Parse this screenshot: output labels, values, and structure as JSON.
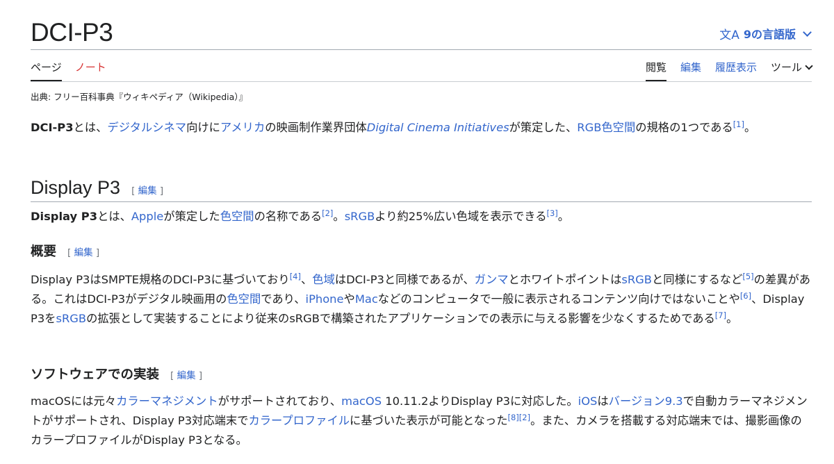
{
  "header": {
    "title": "DCI-P3",
    "language_button": {
      "icon": "文A",
      "label": "9の言語版"
    }
  },
  "tabs": {
    "left": [
      "ページ",
      "ノート"
    ],
    "right": [
      "閲覧",
      "編集",
      "履歴表示",
      "ツール"
    ]
  },
  "tagline": "出典: フリー百科事典『ウィキペディア（Wikipedia）』",
  "edit_label": "編集",
  "intro": {
    "b1": "DCI-P3",
    "t1": "とは、",
    "l1": "デジタルシネマ",
    "t2": "向けに",
    "l2": "アメリカ",
    "t3": "の映画制作業界団体",
    "l3": "Digital Cinema Initiatives",
    "t4": "が策定した、",
    "l4": "RGB色空間",
    "t5": "の規格の1つである",
    "ref1": "[1]",
    "t6": "。"
  },
  "section_display_p3": {
    "heading": "Display P3",
    "b1": "Display P3",
    "t1": "とは、",
    "l1": "Apple",
    "t2": "が策定した",
    "l2": "色空間",
    "t3": "の名称である",
    "ref1": "[2]",
    "t4": "。",
    "l3": "sRGB",
    "t5": "より約25%広い色域を表示できる",
    "ref2": "[3]",
    "t6": "。"
  },
  "section_overview": {
    "heading": "概要",
    "t1": "Display P3はSMPTE規格のDCI-P3に基づいており",
    "ref1": "[4]",
    "t2": "、",
    "l1": "色域",
    "t3": "はDCI-P3と同様であるが、",
    "l2": "ガンマ",
    "t4": "とホワイトポイントは",
    "l3": "sRGB",
    "t5": "と同様にするなど",
    "ref2": "[5]",
    "t6": "の差異がある。これはDCI-P3がデジタル映画用の",
    "l4": "色空間",
    "t7": "であり、",
    "l5": "iPhone",
    "t8": "や",
    "l6": "Mac",
    "t9": "などのコンピュータで一般に表示されるコンテンツ向けではないことや",
    "ref3": "[6]",
    "t10": "、Display P3を",
    "l7": "sRGB",
    "t11": "の拡張として実装することにより従来のsRGBで構築されたアプリケーションでの表示に与える影響を少なくするためである",
    "ref4": "[7]",
    "t12": "。"
  },
  "section_software": {
    "heading": "ソフトウェアでの実装",
    "t1": "macOSには元々",
    "l1": "カラーマネジメント",
    "t2": "がサポートされており、",
    "l2": "macOS",
    "t3": " 10.11.2よりDisplay P3に対応した。",
    "l3": "iOS",
    "t4": "は",
    "l4": "バージョン9.3",
    "t5": "で自動カラーマネジメントがサポートされ、Display P3対応端末で",
    "l5": "カラープロファイル",
    "t6": "に基づいた表示が可能となった",
    "ref1": "[8]",
    "ref2": "[2]",
    "t7": "。また、カメラを搭載する対応端末では、撮影画像のカラープロファイルがDisplay P3となる。"
  }
}
